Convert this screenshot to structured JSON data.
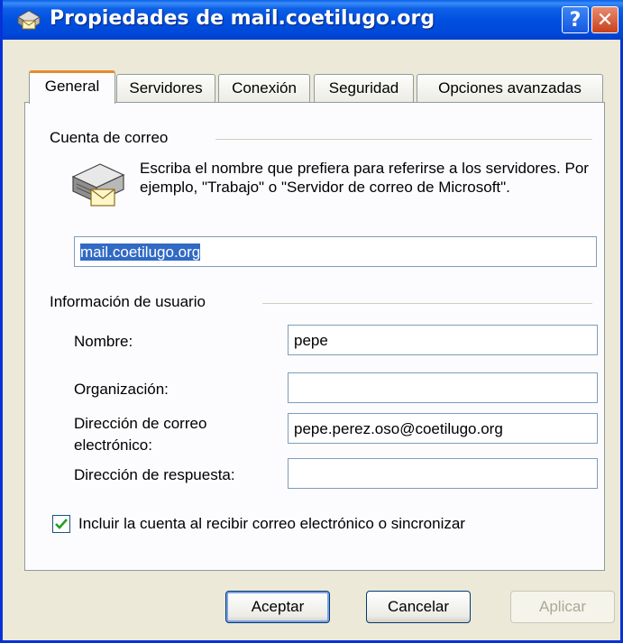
{
  "window": {
    "title": "Propiedades de mail.coetilugo.org",
    "help_label": "?",
    "close_label": "✕"
  },
  "tabs": [
    {
      "label": "General",
      "active": true
    },
    {
      "label": "Servidores",
      "active": false
    },
    {
      "label": "Conexión",
      "active": false
    },
    {
      "label": "Seguridad",
      "active": false
    },
    {
      "label": "Opciones avanzadas",
      "active": false
    }
  ],
  "account_group": {
    "label": "Cuenta de correo",
    "description": "Escriba el nombre que prefiera para referirse a los servidores. Por ejemplo, \"Trabajo\" o \"Servidor de correo de Microsoft\".",
    "icon": "mail-server-icon",
    "account_name_value": "mail.coetilugo.org"
  },
  "user_group": {
    "label": "Información de usuario",
    "name_label": "Nombre:",
    "name_value": "pepe",
    "org_label": "Organización:",
    "org_value": "",
    "email_label_line1": "Dirección de correo",
    "email_label_line2": "electrónico:",
    "email_value": "pepe.perez.oso@coetilugo.org",
    "reply_label": "Dirección de respuesta:",
    "reply_value": ""
  },
  "include_checkbox": {
    "label": "Incluir la cuenta al recibir correo electrónico o sincronizar",
    "checked": true
  },
  "buttons": {
    "ok_label": "Aceptar",
    "cancel_label": "Cancelar",
    "apply_label": "Aplicar"
  },
  "colors": {
    "title_bar": "#0054e3",
    "selection": "#316ac5",
    "dialog_bg": "#ece9d8"
  }
}
